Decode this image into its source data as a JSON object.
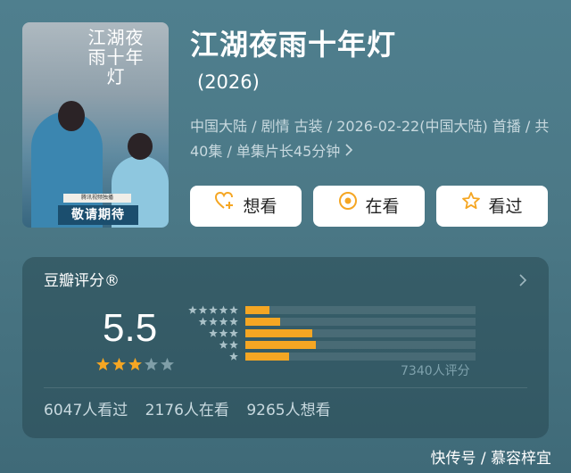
{
  "poster": {
    "title_text": "江湖夜雨十年灯",
    "cta_text": "敬请期待",
    "sub_text": "腾讯视频独播"
  },
  "movie": {
    "title": "江湖夜雨十年灯",
    "year": "(2026)",
    "meta": "中国大陆 / 剧情 古装 / 2026-02-22(中国大陆) 首播 / 共40集 / 单集片长45分钟"
  },
  "actions": {
    "want": "想看",
    "watching": "在看",
    "watched": "看过"
  },
  "rating": {
    "label": "豆瓣评分®",
    "score": "5.5",
    "star_value": 3,
    "star_max": 5,
    "distribution": [
      {
        "stars": 5,
        "fraction": 0.105
      },
      {
        "stars": 4,
        "fraction": 0.151
      },
      {
        "stars": 3,
        "fraction": 0.291
      },
      {
        "stars": 2,
        "fraction": 0.306
      },
      {
        "stars": 1,
        "fraction": 0.19
      }
    ],
    "count_text": "7340人评分"
  },
  "stats": {
    "watched": "6047人看过",
    "watching": "2176人在看",
    "want": "9265人想看"
  },
  "watermark": "快传号 / 慕容梓宜",
  "colors": {
    "accent": "#f5a623",
    "star_empty": "#7f9ea8",
    "button_bg": "#ffffff"
  }
}
